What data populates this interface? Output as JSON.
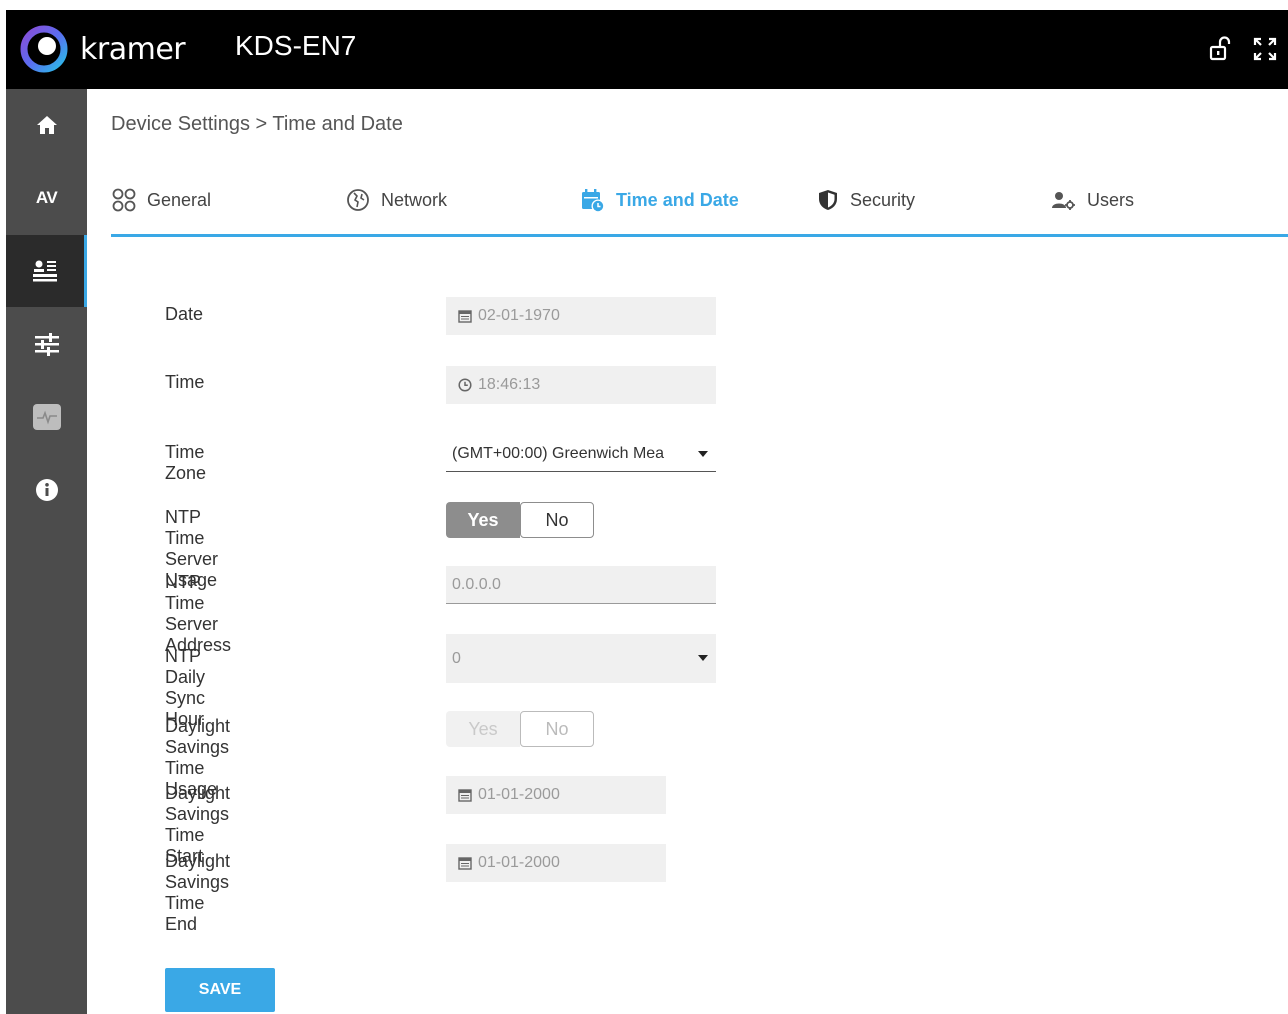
{
  "header": {
    "brand": "kramer",
    "device_name": "KDS-EN7",
    "icons": [
      "lock-open-icon",
      "fullscreen-icon"
    ]
  },
  "sidebar": {
    "items": [
      {
        "name": "home",
        "icon": "home-icon"
      },
      {
        "name": "av",
        "label": "AV"
      },
      {
        "name": "device-settings",
        "icon": "settings-icon",
        "active": true
      },
      {
        "name": "controls",
        "icon": "sliders-icon"
      },
      {
        "name": "diagnostics",
        "icon": "pulse-icon"
      },
      {
        "name": "info",
        "icon": "info-icon"
      }
    ]
  },
  "breadcrumb": "Device Settings > Time and Date",
  "tabs": [
    {
      "label": "General",
      "icon": "general-icon"
    },
    {
      "label": "Network",
      "icon": "network-icon"
    },
    {
      "label": "Time and Date",
      "icon": "calendar-clock-icon",
      "active": true
    },
    {
      "label": "Security",
      "icon": "shield-icon"
    },
    {
      "label": "Users",
      "icon": "users-icon"
    }
  ],
  "form": {
    "date": {
      "label": "Date",
      "value": "02-01-1970"
    },
    "time": {
      "label": "Time",
      "value": "18:46:13"
    },
    "time_zone": {
      "label": "Time Zone",
      "value": "(GMT+00:00) Greenwich Mea"
    },
    "ntp_usage": {
      "label": "NTP Time Server Usage",
      "yes": "Yes",
      "no": "No",
      "selected": "Yes"
    },
    "ntp_address": {
      "label": "NTP Time Server Address",
      "value": "0.0.0.0"
    },
    "ntp_sync_hour": {
      "label": "NTP Daily Sync Hour",
      "value": "0"
    },
    "dst_usage": {
      "label": "Daylight Savings Time Usage",
      "yes": "Yes",
      "no": "No",
      "disabled": true
    },
    "dst_start": {
      "label": "Daylight Savings Time Start",
      "value": "01-01-2000"
    },
    "dst_end": {
      "label": "Daylight Savings Time End",
      "value": "01-01-2000"
    }
  },
  "save_label": "SAVE",
  "colors": {
    "accent": "#3aa8e6",
    "header_bg": "#000000",
    "sidebar_bg": "#4c4c4c",
    "sidebar_active_bg": "#2b2b2b",
    "toggle_selected": "#8d8d8d"
  }
}
